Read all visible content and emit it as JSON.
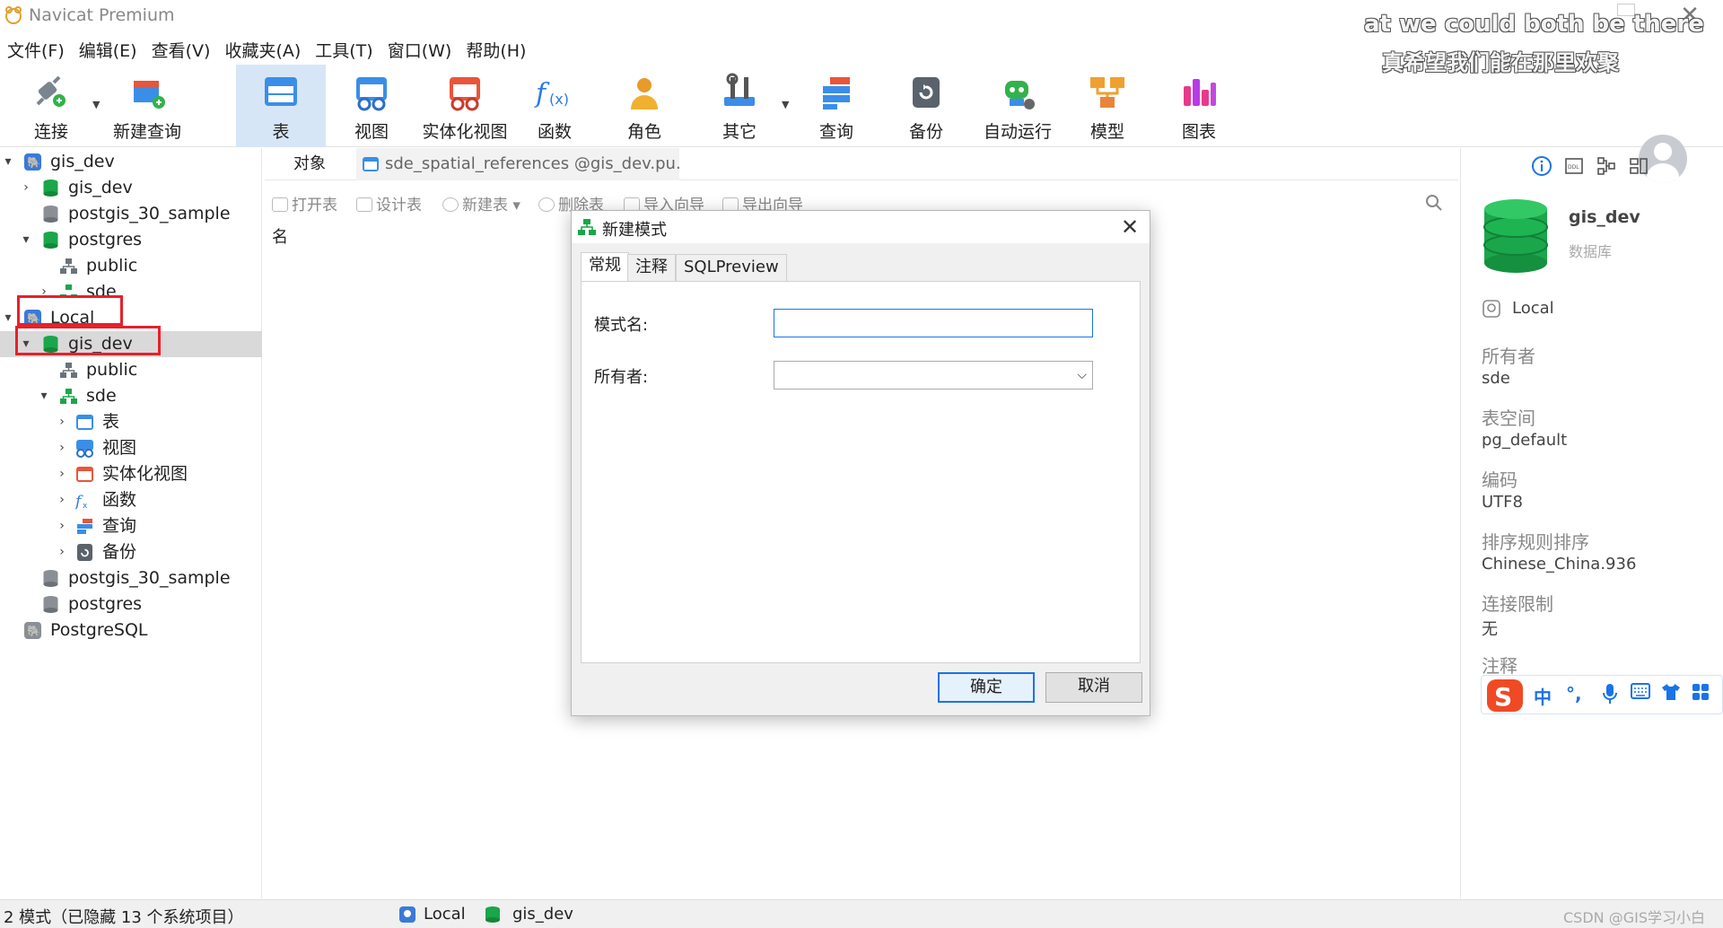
{
  "window": {
    "title": "Navicat Premium"
  },
  "subtitle_overlay": {
    "english": "at we could both be there",
    "chinese": "真希望我们能在那里欢聚"
  },
  "menu": [
    "文件(F)",
    "编辑(E)",
    "查看(V)",
    "收藏夹(A)",
    "工具(T)",
    "窗口(W)",
    "帮助(H)"
  ],
  "toolbar": {
    "items": [
      {
        "label": "连接",
        "icon": "connect-icon"
      },
      {
        "label": "新建查询",
        "icon": "new-query-icon"
      },
      {
        "label": "表",
        "icon": "table-icon",
        "active": true
      },
      {
        "label": "视图",
        "icon": "view-icon"
      },
      {
        "label": "实体化视图",
        "icon": "materialized-view-icon"
      },
      {
        "label": "函数",
        "icon": "function-icon"
      },
      {
        "label": "角色",
        "icon": "role-icon"
      },
      {
        "label": "其它",
        "icon": "other-icon"
      },
      {
        "label": "查询",
        "icon": "query-icon"
      },
      {
        "label": "备份",
        "icon": "backup-icon"
      },
      {
        "label": "自动运行",
        "icon": "automation-icon"
      },
      {
        "label": "模型",
        "icon": "model-icon"
      },
      {
        "label": "图表",
        "icon": "chart-icon"
      }
    ]
  },
  "tree": {
    "nodes": [
      {
        "label": "gis_dev",
        "type": "connection"
      },
      {
        "label": "gis_dev",
        "type": "database"
      },
      {
        "label": "postgis_30_sample",
        "type": "database"
      },
      {
        "label": "postgres",
        "type": "database"
      },
      {
        "label": "public",
        "type": "schema"
      },
      {
        "label": "sde",
        "type": "schema"
      },
      {
        "label": "Local",
        "type": "connection"
      },
      {
        "label": "gis_dev",
        "type": "database"
      },
      {
        "label": "public",
        "type": "schema"
      },
      {
        "label": "sde",
        "type": "schema"
      },
      {
        "label": "表",
        "type": "category"
      },
      {
        "label": "视图",
        "type": "category"
      },
      {
        "label": "实体化视图",
        "type": "category"
      },
      {
        "label": "函数",
        "type": "category"
      },
      {
        "label": "查询",
        "type": "category"
      },
      {
        "label": "备份",
        "type": "category"
      },
      {
        "label": "postgis_30_sample",
        "type": "database"
      },
      {
        "label": "postgres",
        "type": "database"
      },
      {
        "label": "PostgreSQL",
        "type": "connection"
      }
    ],
    "highlight_color": "#e8202a"
  },
  "tabs": {
    "objects": "对象",
    "doc_tab": "sde_spatial_references @gis_dev.pu..."
  },
  "object_toolbar": [
    "打开表",
    "设计表",
    "新建表",
    "删除表",
    "导入向导",
    "导出向导"
  ],
  "object_list": {
    "column_name": "名"
  },
  "dialog": {
    "title": "新建模式",
    "tabs": [
      "常规",
      "注释",
      "SQLPreview"
    ],
    "schema_name_label": "模式名:",
    "schema_name_value": "",
    "owner_label": "所有者:",
    "owner_value": "",
    "ok": "确定",
    "cancel": "取消"
  },
  "right_panel": {
    "db_name": "gis_dev",
    "db_type": "数据库",
    "connection": "Local",
    "fields": [
      {
        "label": "所有者",
        "value": "sde"
      },
      {
        "label": "表空间",
        "value": "pg_default"
      },
      {
        "label": "编码",
        "value": "UTF8"
      },
      {
        "label": "排序规则排序",
        "value": "Chinese_China.936"
      },
      {
        "label": "连接限制",
        "value": "无"
      },
      {
        "label": "注释",
        "value": ""
      }
    ]
  },
  "ime": {
    "items": [
      "中",
      "°,"
    ]
  },
  "status": {
    "text": "2 模式（已隐藏 13 个系统项目）",
    "connection": "Local",
    "database": "gis_dev",
    "right_text": "CSDN @GIS学习小白"
  },
  "colors": {
    "accent": "#1a73e8",
    "db_green": "#1aa64a",
    "selection": "#d9d9d9"
  }
}
